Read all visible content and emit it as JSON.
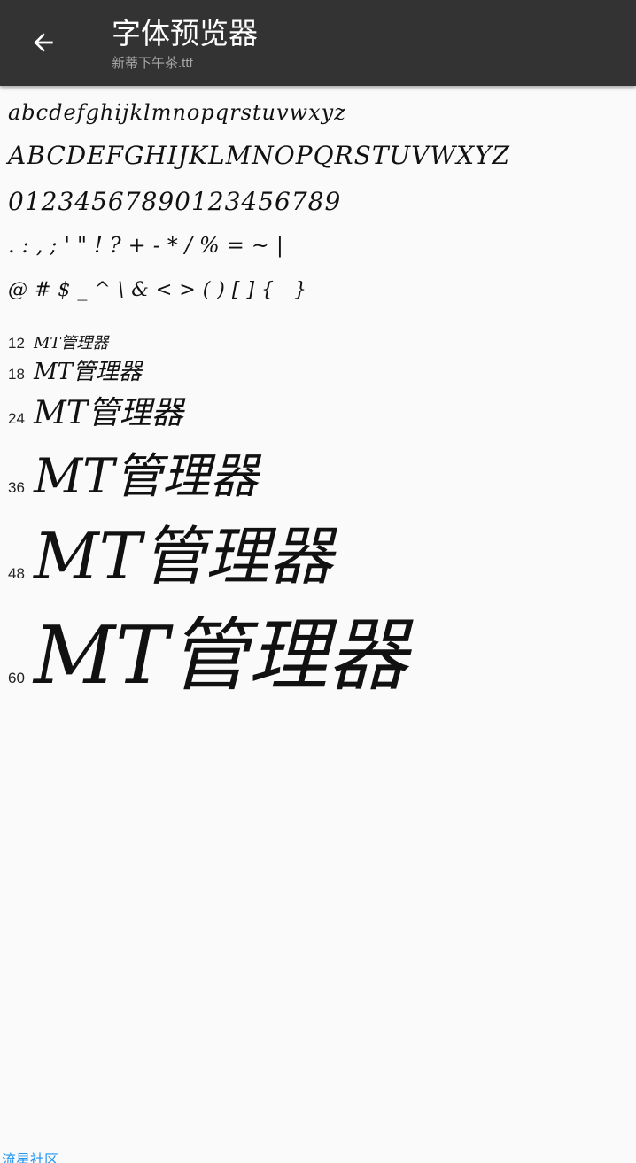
{
  "appbar": {
    "title": "字体预览器",
    "subtitle": "新蒂下午茶.ttf",
    "back_icon": "arrow-left-icon"
  },
  "samples": {
    "lowercase": "abcdefghijklmnopqrstuvwxyz",
    "uppercase": "ABCDEFGHIJKLMNOPQRSTUVWXYZ",
    "digits": "01234567890123456789",
    "punct1": ".:,;'\"!?+-*/%=~|",
    "punct2": "@#$_^\\&<>()[]{ }"
  },
  "sizes": [
    {
      "size": "12",
      "text": "MT管理器"
    },
    {
      "size": "18",
      "text": "MT管理器"
    },
    {
      "size": "24",
      "text": "MT管理器"
    },
    {
      "size": "36",
      "text": "MT管理器"
    },
    {
      "size": "48",
      "text": "MT管理器"
    },
    {
      "size": "60",
      "text": "MT管理器"
    }
  ],
  "watermark": "流星社区",
  "colors": {
    "appbar_bg": "#333333",
    "background": "#fafafa",
    "watermark": "#2196f3"
  }
}
